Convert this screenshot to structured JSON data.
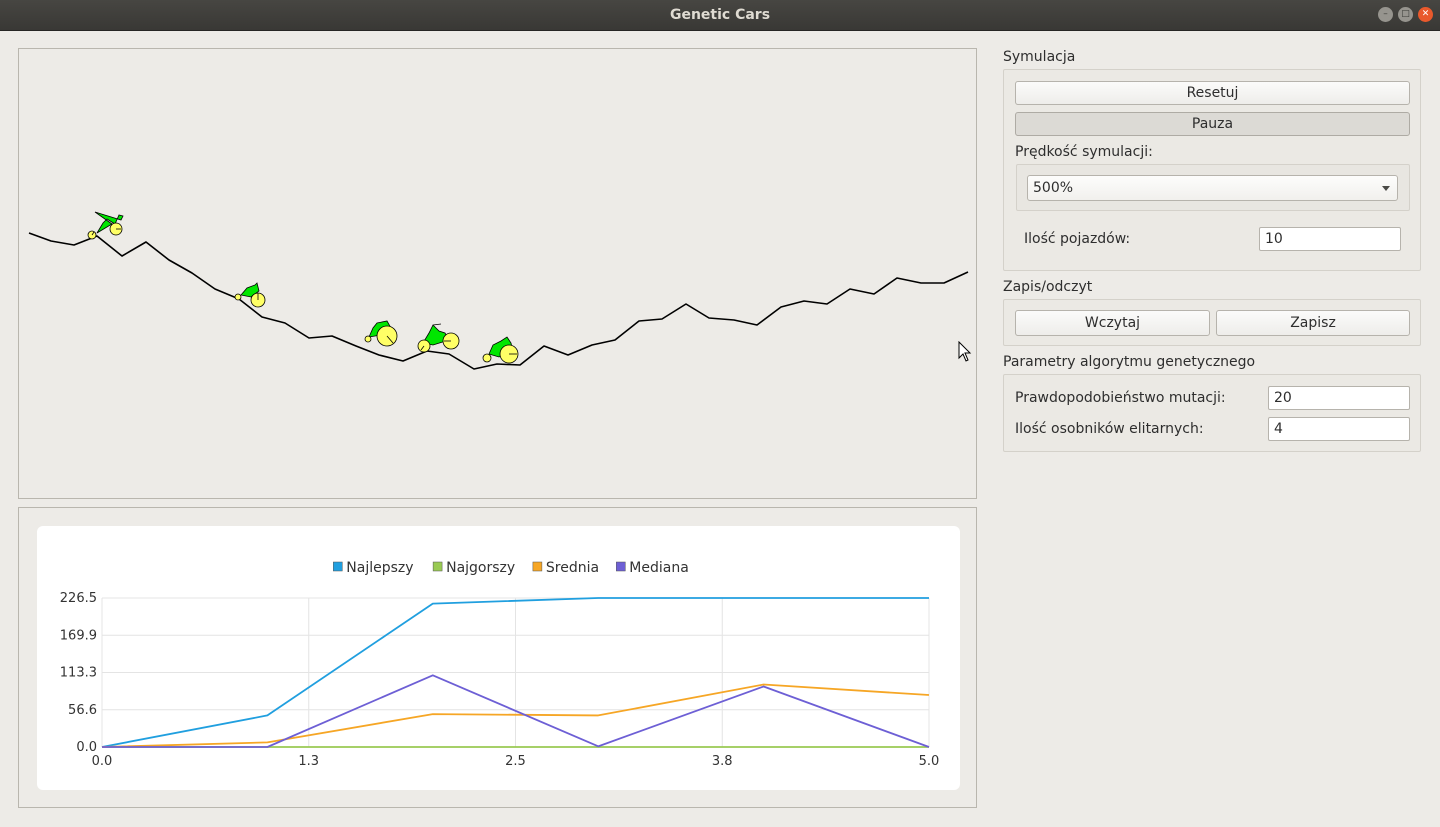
{
  "window": {
    "title": "Genetic Cars",
    "controls": {
      "minimize": "minimize-icon",
      "maximize": "maximize-icon",
      "close": "close-icon"
    }
  },
  "simulation": {
    "group_title": "Symulacja",
    "reset_label": "Resetuj",
    "pause_label": "Pauza",
    "speed_label": "Prędkość symulacji:",
    "speed_value": "500%",
    "vehicles_label": "Ilość pojazdów:",
    "vehicles_value": "10"
  },
  "save_load": {
    "group_title": "Zapis/odczyt",
    "load_label": "Wczytaj",
    "save_label": "Zapisz"
  },
  "ga_params": {
    "group_title": "Parametry algorytmu genetycznego",
    "mutation_label": "Prawdopodobieństwo mutacji:",
    "mutation_value": "20",
    "elite_label": "Ilość osobników elitarnych:",
    "elite_value": "4"
  },
  "colors": {
    "car_body": "#00e600",
    "wheel": "#ffff66",
    "terrain": "#000000",
    "series_best": "#209fdf",
    "series_worst": "#99ca53",
    "series_avg": "#f6a625",
    "series_median": "#6d5fd5"
  },
  "chart_data": {
    "type": "line",
    "title": "",
    "xlabel": "",
    "ylabel": "",
    "legend_position": "top",
    "grid": true,
    "xlim": [
      0,
      5
    ],
    "ylim": [
      0,
      226.5
    ],
    "xticks": [
      "0.0",
      "1.3",
      "2.5",
      "3.8",
      "5.0"
    ],
    "yticks": [
      "0.0",
      "56.6",
      "113.3",
      "169.9",
      "226.5"
    ],
    "x": [
      0,
      1,
      2,
      3,
      4,
      5
    ],
    "series": [
      {
        "name": "Najlepszy",
        "color": "#209fdf",
        "values": [
          0,
          48,
          218,
          226.5,
          226.5,
          226.5
        ]
      },
      {
        "name": "Najgorszy",
        "color": "#99ca53",
        "values": [
          0,
          0,
          0,
          0,
          0,
          0
        ]
      },
      {
        "name": "Srednia",
        "color": "#f6a625",
        "values": [
          0,
          7,
          50,
          48,
          95,
          79
        ]
      },
      {
        "name": "Mediana",
        "color": "#6d5fd5",
        "values": [
          0,
          0,
          109,
          1,
          92,
          0
        ]
      }
    ]
  }
}
